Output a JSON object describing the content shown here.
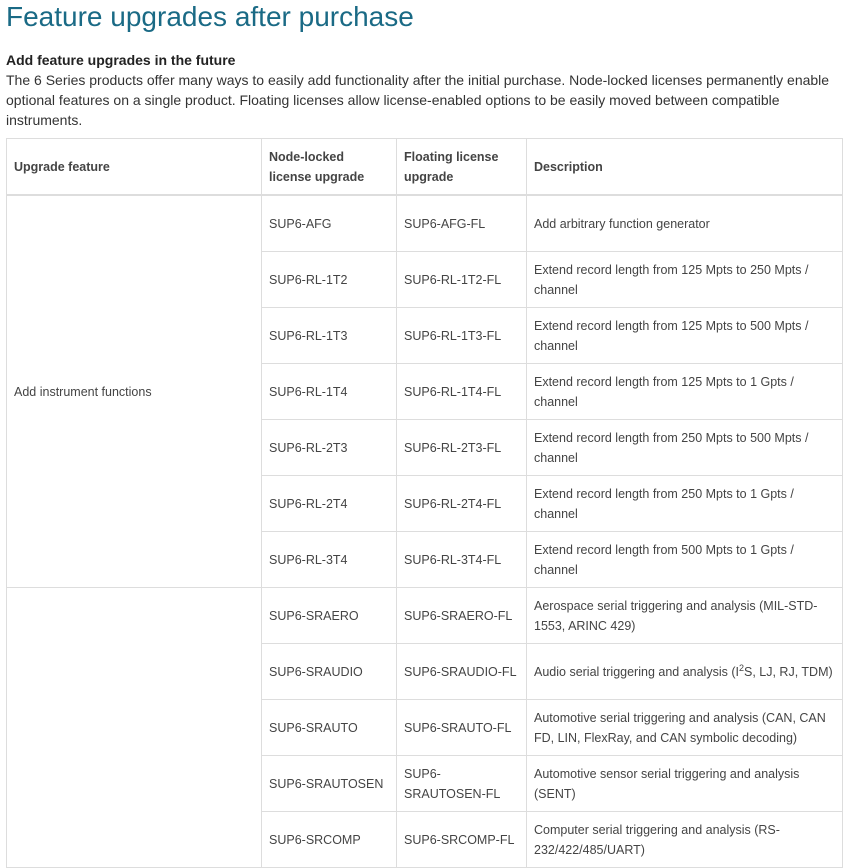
{
  "title": "Feature upgrades after purchase",
  "intro": {
    "heading": "Add feature upgrades in the future",
    "body": "The 6 Series products offer many ways to easily add functionality after the initial purchase. Node-locked licenses permanently enable optional features on a single product. Floating licenses allow license-enabled options to be easily moved between compatible instruments."
  },
  "table": {
    "headers": {
      "feature": "Upgrade feature",
      "node_locked": "Node-locked license upgrade",
      "floating": "Floating license upgrade",
      "description": "Description"
    },
    "groups": [
      {
        "feature": "Add instrument functions",
        "rows": [
          {
            "node_locked": "SUP6-AFG",
            "floating": "SUP6-AFG-FL",
            "description": "Add arbitrary function generator"
          },
          {
            "node_locked": "SUP6-RL-1T2",
            "floating": "SUP6-RL-1T2-FL",
            "description": "Extend record length from 125 Mpts to 250 Mpts / channel"
          },
          {
            "node_locked": "SUP6-RL-1T3",
            "floating": "SUP6-RL-1T3-FL",
            "description": "Extend record length from 125 Mpts to 500 Mpts / channel"
          },
          {
            "node_locked": "SUP6-RL-1T4",
            "floating": "SUP6-RL-1T4-FL",
            "description": "Extend record length from 125 Mpts to 1 Gpts / channel"
          },
          {
            "node_locked": "SUP6-RL-2T3",
            "floating": "SUP6-RL-2T3-FL",
            "description": "Extend record length from 250 Mpts to 500 Mpts / channel"
          },
          {
            "node_locked": "SUP6-RL-2T4",
            "floating": "SUP6-RL-2T4-FL",
            "description": "Extend record length from 250 Mpts to 1 Gpts / channel"
          },
          {
            "node_locked": "SUP6-RL-3T4",
            "floating": "SUP6-RL-3T4-FL",
            "description": "Extend record length from 500 Mpts to 1 Gpts / channel"
          }
        ]
      },
      {
        "feature": "",
        "rows": [
          {
            "node_locked": "SUP6-SRAERO",
            "floating": "SUP6-SRAERO-FL",
            "description": "Aerospace serial triggering and analysis (MIL-STD-1553, ARINC 429)"
          },
          {
            "node_locked": "SUP6-SRAUDIO",
            "floating": "SUP6-SRAUDIO-FL",
            "description_pre": "Audio serial triggering and analysis (I",
            "description_sup": "2",
            "description_post": "S, LJ, RJ, TDM)"
          },
          {
            "node_locked": "SUP6-SRAUTO",
            "floating": "SUP6-SRAUTO-FL",
            "description": "Automotive serial triggering and analysis (CAN, CAN FD, LIN, FlexRay, and CAN symbolic decoding)"
          },
          {
            "node_locked": "SUP6-SRAUTOSEN",
            "floating": "SUP6-SRAUTOSEN-FL",
            "description": "Automotive sensor serial triggering and analysis (SENT)"
          },
          {
            "node_locked": "SUP6-SRCOMP",
            "floating": "SUP6-SRCOMP-FL",
            "description": "Computer serial triggering and analysis (RS-232/422/485/UART)"
          }
        ]
      }
    ]
  }
}
